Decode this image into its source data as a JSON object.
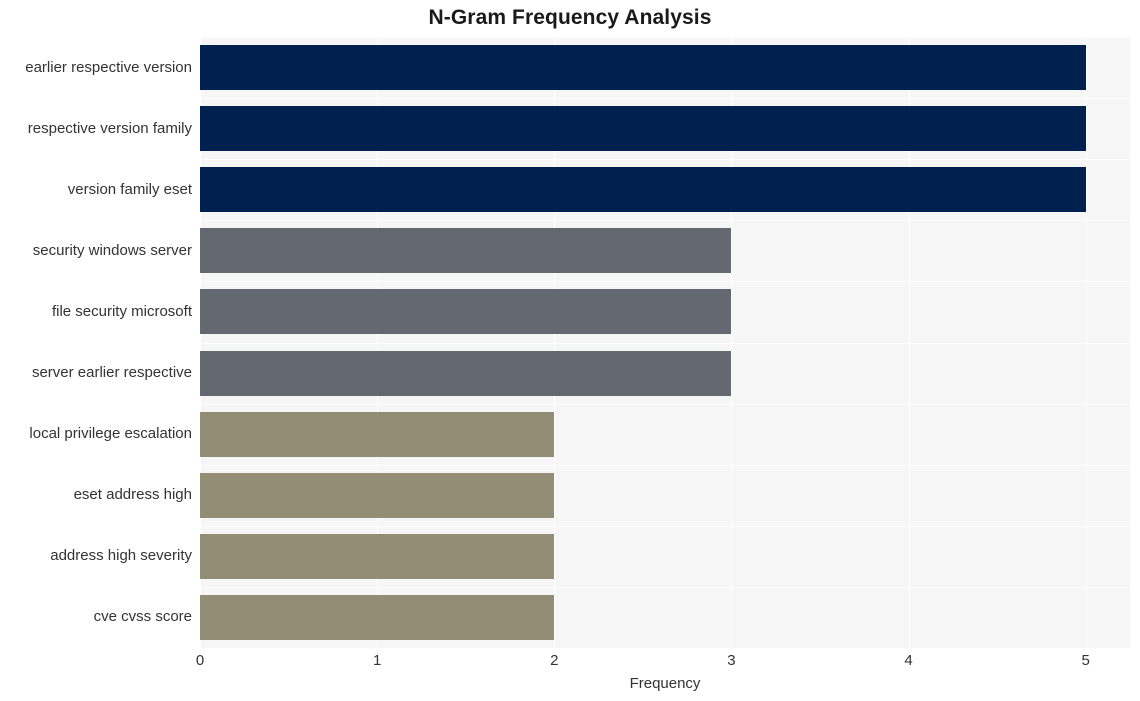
{
  "chart_data": {
    "type": "bar",
    "orientation": "horizontal",
    "title": "N-Gram Frequency Analysis",
    "xlabel": "Frequency",
    "ylabel": "",
    "categories": [
      "earlier respective version",
      "respective version family",
      "version family eset",
      "security windows server",
      "file security microsoft",
      "server earlier respective",
      "local privilege escalation",
      "eset address high",
      "address high severity",
      "cve cvss score"
    ],
    "values": [
      5,
      5,
      5,
      3,
      3,
      3,
      2,
      2,
      2,
      2
    ],
    "bar_colors": [
      "#002050",
      "#002050",
      "#002050",
      "#646870",
      "#646870",
      "#646870",
      "#938d76",
      "#938d76",
      "#938d76",
      "#938d76"
    ],
    "xlim": [
      0,
      5.25
    ],
    "xticks": [
      0,
      1,
      2,
      3,
      4,
      5
    ],
    "xtick_labels": [
      "0",
      "1",
      "2",
      "3",
      "4",
      "5"
    ],
    "grid": true,
    "grid_color": "#ffffff",
    "plot_background": "#f6f6f7",
    "figure_background": "#ffffff",
    "legend": null,
    "palette": {
      "navy": "#002050",
      "gray": "#646870",
      "khaki": "#938d76",
      "text": "#333333",
      "title": "#1a1a1a"
    }
  }
}
